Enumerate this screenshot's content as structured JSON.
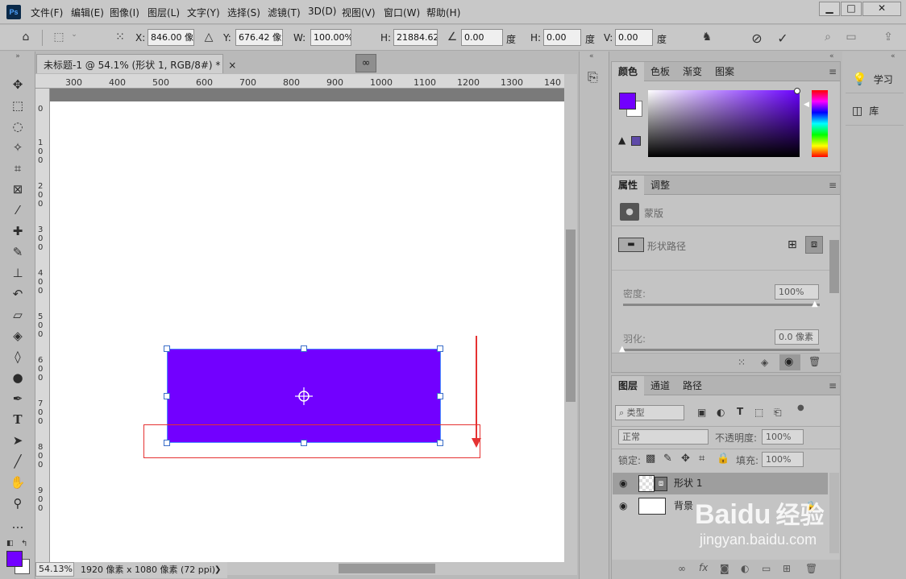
{
  "app": {
    "logo_text": "Ps"
  },
  "menu": [
    "文件(F)",
    "编辑(E)",
    "图像(I)",
    "图层(L)",
    "文字(Y)",
    "选择(S)",
    "滤镜(T)",
    "3D(D)",
    "视图(V)",
    "窗口(W)",
    "帮助(H)"
  ],
  "window_controls": {
    "minimize": "▁",
    "maximize": "□",
    "close": "✕"
  },
  "options_bar": {
    "x_label": "X:",
    "x_value": "846.00 像素",
    "y_label": "Y:",
    "y_value": "676.42 像素",
    "w_label": "W:",
    "w_value": "100.00%",
    "h_label": "H:",
    "h_value": "21884.62",
    "angle_value": "0.00",
    "angle_unit": "度",
    "hskew_label": "H:",
    "hskew_value": "0.00",
    "hskew_unit": "度",
    "vskew_label": "V:",
    "vskew_value": "0.00",
    "vskew_unit": "度"
  },
  "document": {
    "tab_title": "未标题-1 @ 54.1% (形状 1, RGB/8#) *",
    "tab_close": "×",
    "ruler_h": [
      "300",
      "400",
      "500",
      "600",
      "700",
      "800",
      "900",
      "1000",
      "1100",
      "1200",
      "1300",
      "140"
    ],
    "ruler_v": [
      "0",
      "100",
      "200",
      "300",
      "400",
      "500",
      "600",
      "700",
      "800",
      "900"
    ],
    "shape_color": "#7200ff",
    "zoom": "54.13%",
    "doc_info": "1920 像素 x 1080 像素 (72 ppi)",
    "status_arrow": "❯"
  },
  "color_panel": {
    "tabs": [
      "颜色",
      "色板",
      "渐变",
      "图案"
    ],
    "foreground": "#7200ff",
    "background": "#ffffff"
  },
  "properties_panel": {
    "tabs": [
      "属性",
      "调整"
    ],
    "mask_label": "蒙版",
    "shape_path_label": "形状路径",
    "density_label": "密度:",
    "density_value": "100%",
    "feather_label": "羽化:",
    "feather_value": "0.0 像素"
  },
  "layers_panel": {
    "tabs": [
      "图层",
      "通道",
      "路径"
    ],
    "filter_label": "类型",
    "blend_mode": "正常",
    "opacity_label": "不透明度:",
    "opacity_value": "100%",
    "lock_label": "锁定:",
    "fill_label": "填充:",
    "fill_value": "100%",
    "layers": [
      {
        "name": "形状 1",
        "selected": true
      },
      {
        "name": "背景",
        "selected": false
      }
    ]
  },
  "right_strip": {
    "learn": "学习",
    "library": "库"
  },
  "watermark": {
    "brand": "Baidu",
    "brand2": "经验",
    "url": "jingyan.baidu.com"
  }
}
